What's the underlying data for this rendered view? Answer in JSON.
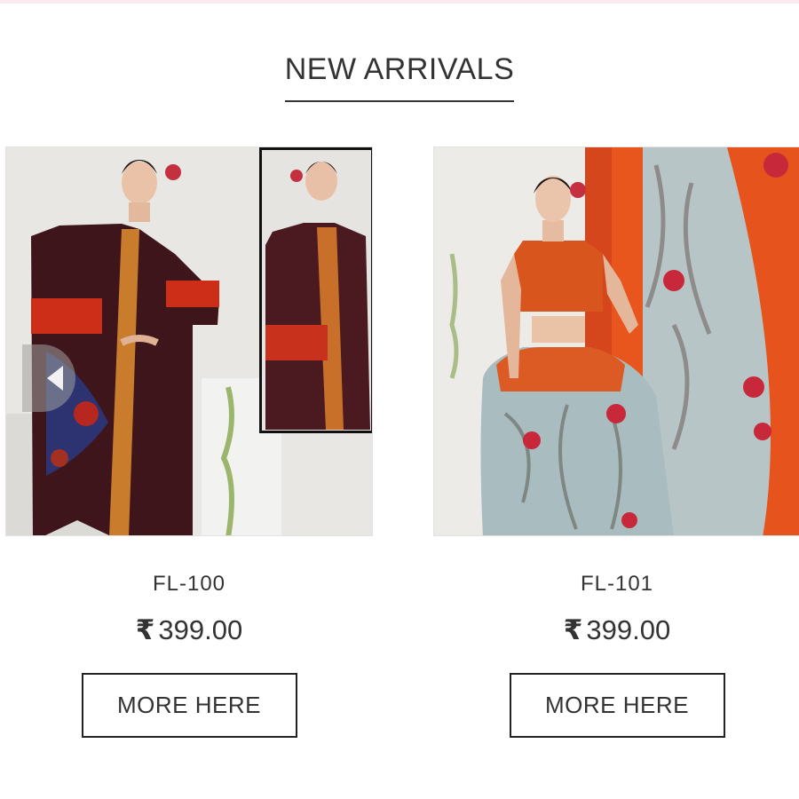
{
  "section": {
    "title": "NEW ARRIVALS"
  },
  "products": [
    {
      "code": "FL-100",
      "currency_symbol": "₹",
      "price": "399.00",
      "button_label": "MORE HERE"
    },
    {
      "code": "FL-101",
      "currency_symbol": "₹",
      "price": "399.00",
      "button_label": "MORE HERE"
    }
  ],
  "icons": {
    "carousel_prev": "chevron-left-icon"
  },
  "colors": {
    "text": "#333333",
    "border": "#222222",
    "background": "#ffffff"
  }
}
